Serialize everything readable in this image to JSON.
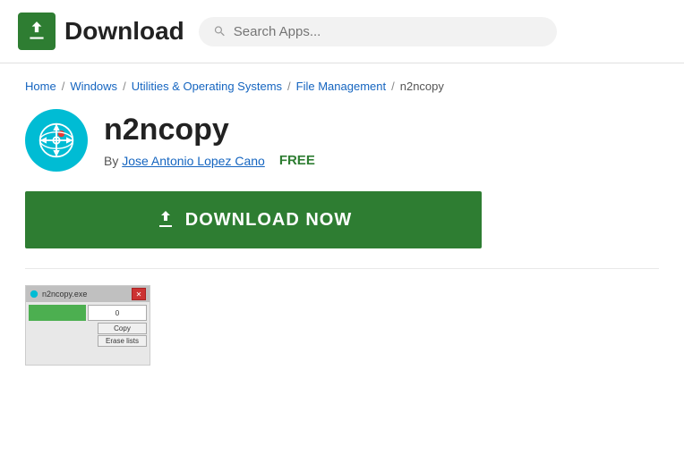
{
  "header": {
    "logo_text": "Download",
    "search_placeholder": "Search Apps..."
  },
  "breadcrumb": {
    "items": [
      {
        "label": "Home",
        "url": "#",
        "link": true
      },
      {
        "label": "Windows",
        "url": "#",
        "link": true
      },
      {
        "label": "Utilities & Operating Systems",
        "url": "#",
        "link": true
      },
      {
        "label": "File Management",
        "url": "#",
        "link": true
      },
      {
        "label": "n2ncopy",
        "link": false
      }
    ]
  },
  "app": {
    "name": "n2ncopy",
    "author_prefix": "By ",
    "author_name": "Jose Antonio Lopez Cano",
    "price": "FREE",
    "download_button": "DOWNLOAD NOW"
  },
  "screenshot": {
    "title": "n2ncopy.exe",
    "progress_label": "0",
    "btn1": "Copy",
    "btn2": "Erase lists"
  }
}
